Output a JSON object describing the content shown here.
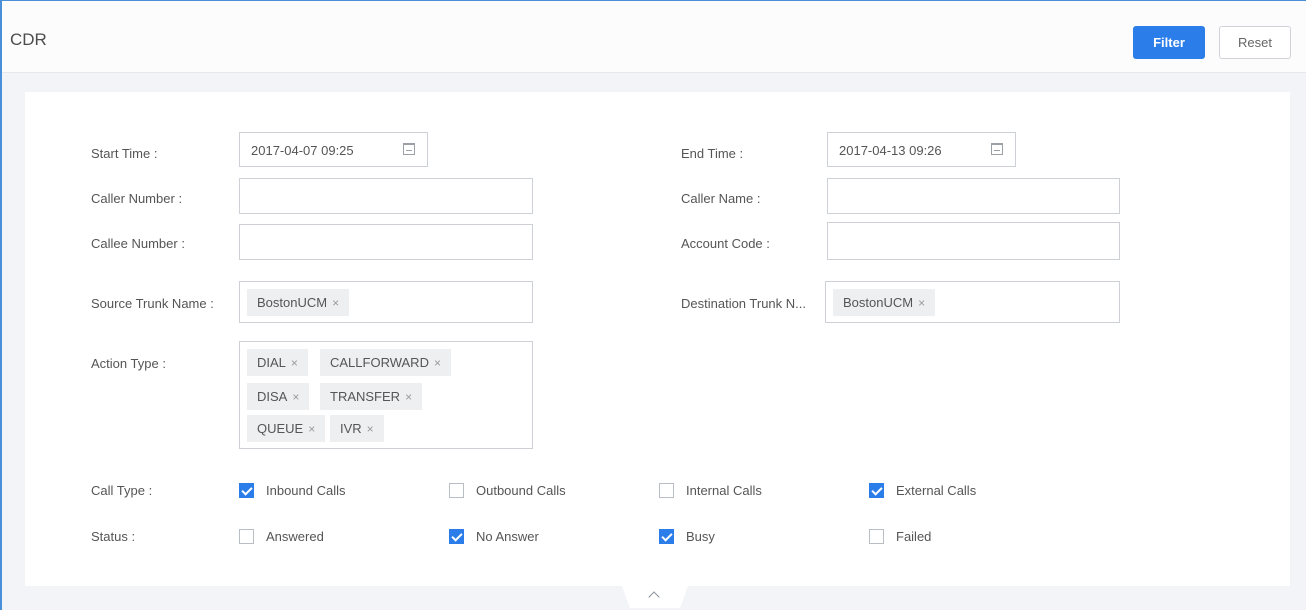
{
  "header": {
    "title": "CDR",
    "filter_label": "Filter",
    "reset_label": "Reset"
  },
  "form": {
    "start_time": {
      "label": "Start Time",
      "value": "2017-04-07 09:25"
    },
    "end_time": {
      "label": "End Time",
      "value": "2017-04-13 09:26"
    },
    "caller_number": {
      "label": "Caller Number",
      "value": ""
    },
    "caller_name": {
      "label": "Caller Name",
      "value": ""
    },
    "callee_number": {
      "label": "Callee Number",
      "value": ""
    },
    "account_code": {
      "label": "Account Code",
      "value": ""
    },
    "source_trunk": {
      "label": "Source Trunk Name",
      "tags": [
        "BostonUCM"
      ]
    },
    "destination_trunk": {
      "label": "Destination Trunk N...",
      "tags": [
        "BostonUCM"
      ]
    },
    "action_type": {
      "label": "Action Type",
      "tags": [
        "DIAL",
        "CALLFORWARD",
        "DISA",
        "TRANSFER",
        "QUEUE",
        "IVR"
      ]
    },
    "call_type": {
      "label": "Call Type",
      "options": [
        {
          "label": "Inbound Calls",
          "checked": true
        },
        {
          "label": "Outbound Calls",
          "checked": false
        },
        {
          "label": "Internal Calls",
          "checked": false
        },
        {
          "label": "External Calls",
          "checked": true
        }
      ]
    },
    "status": {
      "label": "Status",
      "options": [
        {
          "label": "Answered",
          "checked": false
        },
        {
          "label": "No Answer",
          "checked": true
        },
        {
          "label": "Busy",
          "checked": true
        },
        {
          "label": "Failed",
          "checked": false
        }
      ]
    },
    "colon": ":"
  },
  "colors": {
    "accent": "#2b7de9",
    "frame_border": "#4a90d9"
  },
  "icons": {
    "calendar": "calendar-icon",
    "tag_remove": "close-icon",
    "collapse": "chevron-up-icon"
  },
  "glyphs": {
    "remove": "×"
  }
}
